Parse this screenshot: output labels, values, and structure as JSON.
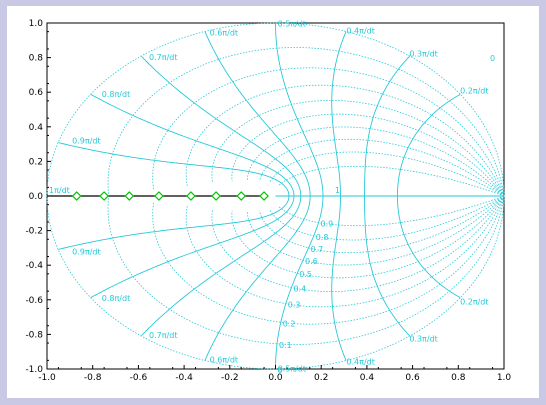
{
  "chart_data": {
    "type": "zgrid",
    "title": "",
    "xlabel": "",
    "ylabel": "",
    "xlim": [
      -1.0,
      1.0
    ],
    "ylim": [
      -1.0,
      1.0
    ],
    "xticks": [
      "-1.0",
      "-0.8",
      "-0.6",
      "-0.4",
      "-0.2",
      "0.0",
      "0.2",
      "0.4",
      "0.6",
      "0.8",
      "1.0"
    ],
    "yticks": [
      "1.0",
      "0.8",
      "0.6",
      "0.4",
      "0.2",
      "0.0",
      "-0.2",
      "-0.4",
      "-0.6",
      "-0.8",
      "-1.0"
    ],
    "damping_labels": [
      "0",
      "0.9",
      "0.8",
      "0.7",
      "0.6",
      "0.5",
      "0.4",
      "0.3",
      "0.2",
      "0.1",
      "0",
      "1"
    ],
    "frequency_labels": [
      "0.9π/dt",
      "0.8π/dt",
      "0.7π/dt",
      "0.6π/dt",
      "0.5π/dt",
      "0.4π/dt",
      "0.3π/dt",
      "0.2π/dt",
      "1π/dt"
    ],
    "frequency_values": [
      0.9,
      0.8,
      0.7,
      0.6,
      0.5,
      0.4,
      0.3,
      0.2
    ],
    "damping_values": [
      0.1,
      0.2,
      0.3,
      0.4,
      0.5,
      0.6,
      0.7,
      0.8,
      0.9
    ],
    "series": [
      {
        "points": [
          {
            "x": -0.87,
            "y": 0.0
          },
          {
            "x": -0.75,
            "y": 0.0
          },
          {
            "x": -0.64,
            "y": 0.0
          },
          {
            "x": -0.51,
            "y": 0.0
          },
          {
            "x": -0.37,
            "y": 0.0
          },
          {
            "x": -0.26,
            "y": 0.0
          },
          {
            "x": -0.15,
            "y": 0.0
          },
          {
            "x": -0.05,
            "y": 0.0
          }
        ],
        "color": "#00c000",
        "marker": "diamond"
      }
    ],
    "grid_color": "#26c9d9",
    "line_color": "#000000"
  }
}
